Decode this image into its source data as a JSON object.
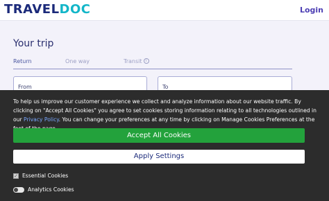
{
  "header": {
    "logo_part1": "TRAVEL",
    "logo_part2": "DOC",
    "login_label": "Login"
  },
  "trip": {
    "title": "Your trip",
    "tabs": [
      {
        "label": "Return",
        "active": true
      },
      {
        "label": "One way",
        "active": false
      },
      {
        "label": "Transit",
        "active": false,
        "icon": "info-icon"
      }
    ],
    "from_label": "From",
    "to_label": "To"
  },
  "cookie_banner": {
    "text_before_link": "To help us improve our customer experience we collect and analyze information about our website traffic. By clicking on \"Accept All Cookies\" you agree to set cookies storing information relating to all technologies outlined in our ",
    "link_text": "Privacy Policy",
    "text_after_link": ". You can change your preferences at any time by clicking on Manage Cookies Preferences at the foot of the page.",
    "accept_label": "Accept All Cookies",
    "apply_label": "Apply Settings",
    "options": [
      {
        "label": "Essential Cookies",
        "control": "checkbox",
        "checked": true
      },
      {
        "label": "Analytics Cookies",
        "control": "toggle",
        "on": false
      }
    ]
  },
  "colors": {
    "brand_navy": "#1b2a7a",
    "brand_teal": "#13b6c8",
    "accept_green": "#23a23c",
    "overlay": "#2c2c2c"
  }
}
